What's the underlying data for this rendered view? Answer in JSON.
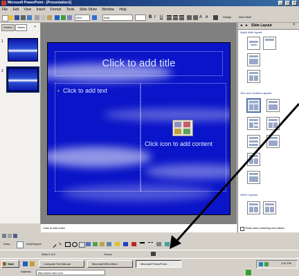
{
  "window": {
    "title": "Microsoft PowerPoint - [Presentation1]"
  },
  "menu": [
    "File",
    "Edit",
    "View",
    "Insert",
    "Format",
    "Tools",
    "Slide Show",
    "Window",
    "Help"
  ],
  "toolbar": {
    "zoom": "49%",
    "font": "Arial",
    "design_label": "Design",
    "new_slide_label": "New Slide"
  },
  "left_tabs": [
    "Outline",
    "Slides"
  ],
  "thumbnails": [
    "1",
    "2"
  ],
  "slide": {
    "title_placeholder": "Click to add title",
    "text_placeholder": "Click to add text",
    "content_placeholder": "Click icon to add content"
  },
  "task_pane": {
    "title": "Slide Layout",
    "section_apply": "Apply slide layout:",
    "section_text_content": "Text and Content Layouts",
    "section_other": "Other Layouts",
    "checkbox_label": "Show when inserting new slides"
  },
  "notes": {
    "placeholder": "Click to add notes"
  },
  "drawing": {
    "draw_label": "Draw",
    "autoshapes_label": "AutoShapes"
  },
  "status": {
    "slide_info": "Slide 2 of 2",
    "design": "Ocean"
  },
  "taskbar": {
    "start_label": "Start",
    "buttons": [
      "Computer Set Manual",
      "Microsoft IDEs Micro",
      "Microsoft PowerPoint..."
    ],
    "clock": "1:51 PM"
  },
  "address": {
    "label": "Address",
    "value": "http://www.msn.com"
  },
  "colors": {
    "slide_bg": "#0a14c8",
    "title_bar": "#0a246a",
    "arrow": "#000000"
  }
}
